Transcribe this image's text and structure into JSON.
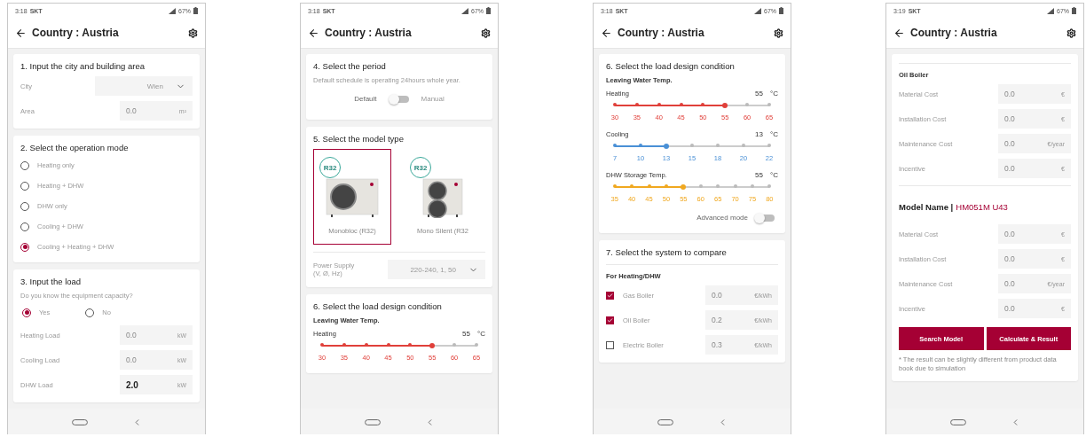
{
  "phones": [
    {
      "status": {
        "time": "3:18",
        "carrier": "SKT",
        "battery": "67%"
      },
      "header": {
        "title": "Country : Austria"
      },
      "cards": [
        {
          "items": [
            {
              "kind": "heading",
              "text": "1. Input the city and building area"
            },
            {
              "kind": "select",
              "label": "City",
              "value": "Wien"
            },
            {
              "kind": "field",
              "label": "Area",
              "placeholder": "0.0",
              "unit": "m²"
            }
          ]
        },
        {
          "items": [
            {
              "kind": "heading",
              "text": "2. Select the operation mode"
            },
            {
              "kind": "radio",
              "label": "Heating only",
              "selected": false
            },
            {
              "kind": "radio",
              "label": "Heating + DHW",
              "selected": false
            },
            {
              "kind": "radio",
              "label": "DHW only",
              "selected": false
            },
            {
              "kind": "radio",
              "label": "Cooling + DHW",
              "selected": false
            },
            {
              "kind": "radio",
              "label": "Cooling + Heating + DHW",
              "selected": true
            }
          ]
        },
        {
          "items": [
            {
              "kind": "heading",
              "text": "3. Input the load"
            },
            {
              "kind": "note",
              "text": "Do you know the equipment capacity?"
            },
            {
              "kind": "radio_row",
              "options": [
                {
                  "label": "Yes",
                  "selected": true
                },
                {
                  "label": "No",
                  "selected": false
                }
              ]
            },
            {
              "kind": "field",
              "label": "Heating Load",
              "placeholder": "0.0",
              "unit": "kW"
            },
            {
              "kind": "field",
              "label": "Cooling Load",
              "placeholder": "0.0",
              "unit": "kW"
            },
            {
              "kind": "field",
              "label": "DHW Load",
              "value": "2.0",
              "unit": "kW"
            }
          ]
        }
      ]
    },
    {
      "status": {
        "time": "3:18",
        "carrier": "SKT",
        "battery": "67%"
      },
      "header": {
        "title": "Country : Austria"
      },
      "cards": [
        {
          "items": [
            {
              "kind": "heading",
              "text": "4. Select the period"
            },
            {
              "kind": "note",
              "text": "Default schedule is operating 24hours whole year."
            },
            {
              "kind": "toggle",
              "left": "Default",
              "right": "Manual",
              "on": false
            }
          ]
        },
        {
          "items": [
            {
              "kind": "heading",
              "text": "5. Select the model type"
            },
            {
              "kind": "models",
              "items": [
                {
                  "name": "Monobloc (R32)",
                  "badge": "R32",
                  "kind": "single_fan",
                  "selected": true
                },
                {
                  "name": "Mono Silent (R32",
                  "badge": "R32",
                  "kind": "double_fan",
                  "selected": false
                }
              ]
            },
            {
              "kind": "divider"
            },
            {
              "kind": "select",
              "label": "Power Supply",
              "label_2": "(V, Ø, Hz)",
              "value": "220-240, 1, 50"
            }
          ]
        },
        {
          "items": [
            {
              "kind": "heading",
              "text": "6. Select the load design condition"
            },
            {
              "kind": "subheading",
              "text": "Leaving Water Temp."
            },
            {
              "kind": "slider",
              "label": "Heating",
              "reading": "55",
              "unit": "°C",
              "color": "#e0403a",
              "ticks": [
                "30",
                "35",
                "40",
                "45",
                "50",
                "55",
                "60",
                "65"
              ],
              "level": 0.714
            }
          ]
        }
      ]
    },
    {
      "status": {
        "time": "3:18",
        "carrier": "SKT",
        "battery": "67%"
      },
      "header": {
        "title": "Country : Austria"
      },
      "cards": [
        {
          "items": [
            {
              "kind": "heading",
              "text": "6. Select the load design condition"
            },
            {
              "kind": "subheading",
              "text": "Leaving Water Temp."
            },
            {
              "kind": "slider",
              "label": "Heating",
              "reading": "55",
              "unit": "°C",
              "color": "#e0403a",
              "ticks": [
                "30",
                "35",
                "40",
                "45",
                "50",
                "55",
                "60",
                "65"
              ],
              "level": 0.714
            },
            {
              "kind": "slider",
              "label": "Cooling",
              "reading": "13",
              "unit": "°C",
              "color": "#4a90d6",
              "ticks": [
                "7",
                "10",
                "13",
                "15",
                "18",
                "20",
                "22"
              ],
              "level": 0.333
            },
            {
              "kind": "slider",
              "label": "DHW Storage Temp.",
              "reading": "55",
              "unit": "°C",
              "color": "#f0a820",
              "ticks": [
                "35",
                "40",
                "45",
                "50",
                "55",
                "60",
                "65",
                "70",
                "75",
                "80"
              ],
              "level": 0.444
            },
            {
              "kind": "switch",
              "label": "Advanced mode",
              "on": false
            }
          ]
        },
        {
          "items": [
            {
              "kind": "heading",
              "text": "7. Select the system to compare"
            },
            {
              "kind": "divider"
            },
            {
              "kind": "subheading",
              "text": "For Heating/DHW"
            },
            {
              "kind": "check_field",
              "label": "Gas Boiler",
              "checked": true,
              "placeholder": "0.0",
              "unit": "€/kWh"
            },
            {
              "kind": "check_field",
              "label": "Oil Boiler",
              "checked": true,
              "placeholder": "0.2",
              "unit": "€/kWh"
            },
            {
              "kind": "check_field",
              "label": "Electric Boiler",
              "checked": false,
              "placeholder": "0.3",
              "unit": "€/kWh"
            }
          ]
        }
      ]
    },
    {
      "status": {
        "time": "3:19",
        "carrier": "SKT",
        "battery": "67%"
      },
      "header": {
        "title": "Country : Austria"
      },
      "cards": [
        {
          "items": [
            {
              "kind": "divider"
            },
            {
              "kind": "subheading",
              "text": "Oil Boiler"
            },
            {
              "kind": "field",
              "label": "Material Cost",
              "placeholder": "0.0",
              "unit": "€"
            },
            {
              "kind": "field",
              "label": "Installation Cost",
              "placeholder": "0.0",
              "unit": "€"
            },
            {
              "kind": "field",
              "label": "Maintenance Cost",
              "placeholder": "0.0",
              "unit": "€/year"
            },
            {
              "kind": "field",
              "label": "Incentive",
              "placeholder": "0.0",
              "unit": "€"
            },
            {
              "kind": "divider"
            },
            {
              "kind": "model_name",
              "label": "Model Name |",
              "value": "HM051M U43"
            },
            {
              "kind": "field",
              "label": "Material Cost",
              "placeholder": "0.0",
              "unit": "€"
            },
            {
              "kind": "field",
              "label": "Installation Cost",
              "placeholder": "0.0",
              "unit": "€"
            },
            {
              "kind": "field",
              "label": "Maintenance Cost",
              "placeholder": "0.0",
              "unit": "€/year"
            },
            {
              "kind": "field",
              "label": "Incentive",
              "placeholder": "0.0",
              "unit": "€"
            },
            {
              "kind": "buttons",
              "labels": [
                "Search Model",
                "Calculate & Result"
              ]
            },
            {
              "kind": "footnote",
              "text": "* The result can be slightly different from product data book due to simulation"
            }
          ]
        }
      ]
    }
  ]
}
